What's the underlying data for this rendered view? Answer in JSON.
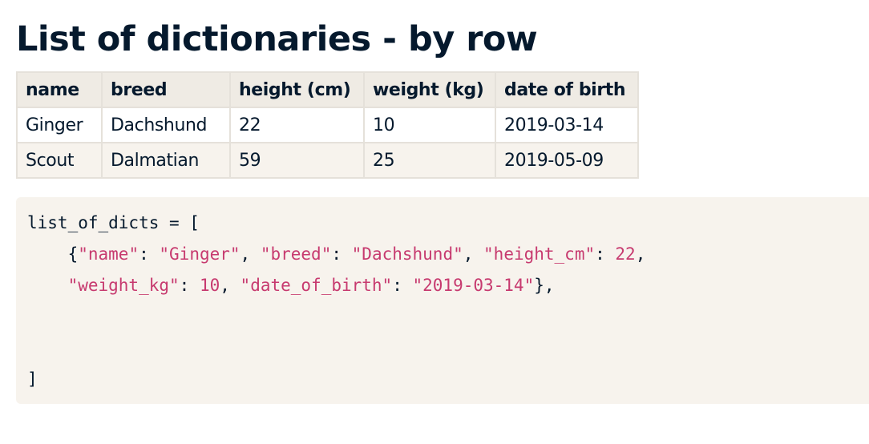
{
  "title": "List of dictionaries - by row",
  "table": {
    "headers": [
      "name",
      "breed",
      "height (cm)",
      "weight (kg)",
      "date of birth"
    ],
    "rows": [
      [
        "Ginger",
        "Dachshund",
        "22",
        "10",
        "2019-03-14"
      ],
      [
        "Scout",
        "Dalmatian",
        "59",
        "25",
        "2019-05-09"
      ]
    ]
  },
  "code": {
    "line1": "list_of_dicts = [",
    "l2_open": "{",
    "l2_k1": "\"name\"",
    "l2_s1": ": ",
    "l2_v1": "\"Ginger\"",
    "l2_s2": ", ",
    "l2_k2": "\"breed\"",
    "l2_s3": ": ",
    "l2_v2": "\"Dachshund\"",
    "l2_s4": ", ",
    "l2_k3": "\"height_cm\"",
    "l2_s5": ": ",
    "l2_v3": "22",
    "l2_s6": ",",
    "l3_k4": "\"weight_kg\"",
    "l3_s1": ": ",
    "l3_v4": "10",
    "l3_s2": ", ",
    "l3_k5": "\"date_of_birth\"",
    "l3_s3": ": ",
    "l3_v5": "\"2019-03-14\"",
    "l3_close": "},",
    "line6": "]"
  },
  "colors": {
    "heading": "#05192d",
    "string": "#c73a6f",
    "code_bg": "#f7f3ed",
    "table_header_bg": "#efebe4"
  }
}
